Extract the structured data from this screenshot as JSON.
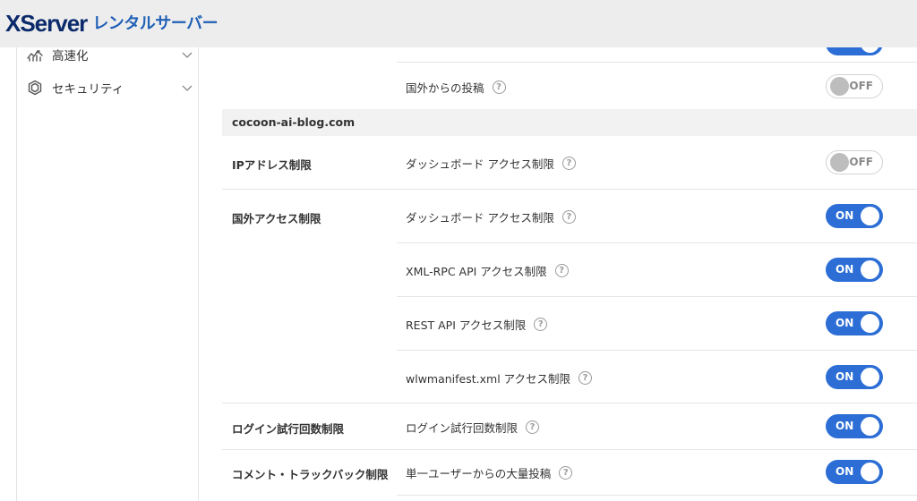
{
  "header": {
    "logo_en": "XServer",
    "logo_jp": "レンタルサーバー"
  },
  "sidebar": {
    "items": [
      {
        "label": "高速化",
        "icon": "speed-icon"
      },
      {
        "label": "セキュリティ",
        "icon": "shield-icon"
      }
    ]
  },
  "main": {
    "top_row": {
      "label": "国外からの投稿",
      "state": "OFF"
    },
    "domain": "cocoon-ai-blog.com",
    "groups": [
      {
        "title": "IPアドレス制限"
      },
      {
        "title": "国外アクセス制限"
      },
      {
        "title": "ログイン試行回数制限"
      },
      {
        "title": "コメント・トラックバック制限"
      }
    ],
    "settings": [
      {
        "label": "ダッシュボード アクセス制限",
        "state": "OFF"
      },
      {
        "label": "ダッシュボード アクセス制限",
        "state": "ON"
      },
      {
        "label": "XML-RPC API アクセス制限",
        "state": "ON"
      },
      {
        "label": "REST API アクセス制限",
        "state": "ON"
      },
      {
        "label": "wlwmanifest.xml アクセス制限",
        "state": "ON"
      },
      {
        "label": "ログイン試行回数制限",
        "state": "ON"
      },
      {
        "label": "単一ユーザーからの大量投稿",
        "state": "ON"
      }
    ],
    "help_glyph": "?"
  },
  "colors": {
    "toggle_on": "#2c6ed5",
    "logo_dark": "#0b2a6b",
    "logo_blue": "#2161b7"
  }
}
